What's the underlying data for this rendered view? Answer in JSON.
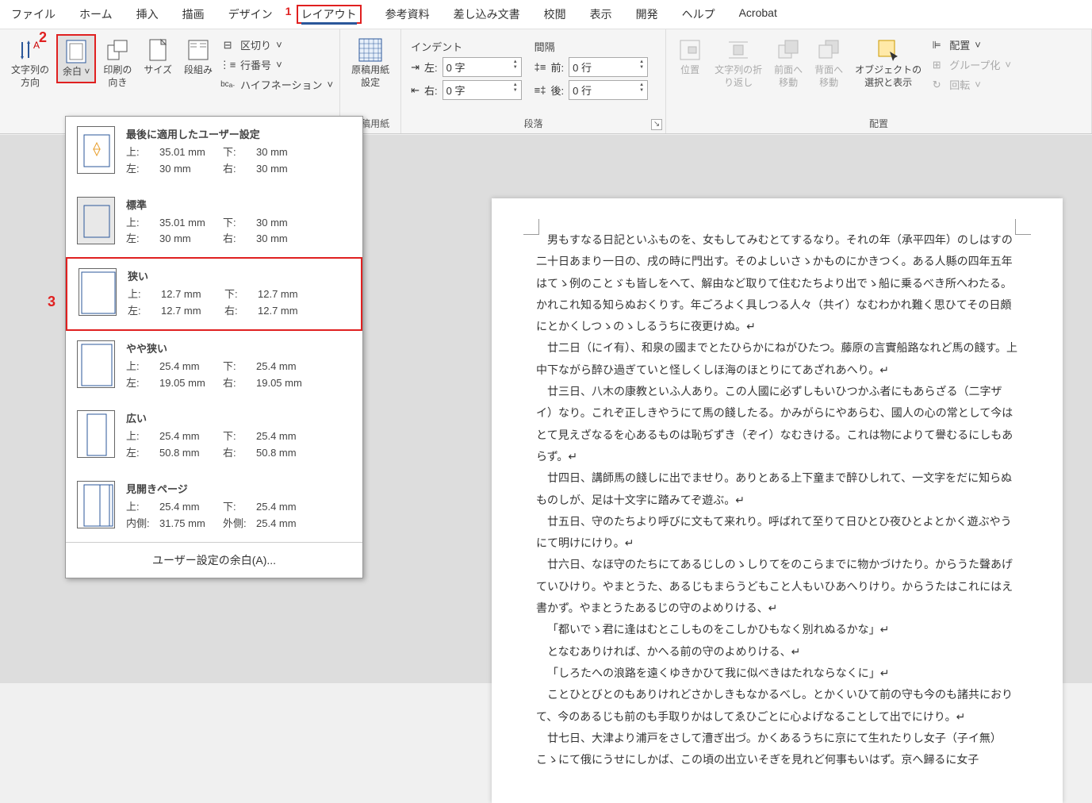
{
  "menu": [
    "ファイル",
    "ホーム",
    "挿入",
    "描画",
    "デザイン",
    "レイアウト",
    "参考資料",
    "差し込み文書",
    "校閲",
    "表示",
    "開発",
    "ヘルプ",
    "Acrobat"
  ],
  "annotations": {
    "layout": "1",
    "margins": "2",
    "narrow": "3"
  },
  "ribbon": {
    "text_direction": {
      "label": "文字列の\n方向"
    },
    "margins": {
      "label": "余白"
    },
    "orientation": {
      "label": "印刷の\n向き"
    },
    "size": {
      "label": "サイズ"
    },
    "columns": {
      "label": "段組み"
    },
    "breaks": {
      "label": "区切り"
    },
    "line_numbers": {
      "label": "行番号"
    },
    "hyphenation": {
      "label": "ハイフネーション"
    },
    "manuscript": {
      "label": "原稿用紙\n設定",
      "group": "原稿用紙"
    },
    "paragraph": {
      "group": "段落",
      "indent_hdr": "インデント",
      "spacing_hdr": "間隔",
      "left_lbl": "左:",
      "left_val": "0 字",
      "right_lbl": "右:",
      "right_val": "0 字",
      "before_lbl": "前:",
      "before_val": "0 行",
      "after_lbl": "後:",
      "after_val": "0 行"
    },
    "arrange": {
      "group": "配置",
      "position": "位置",
      "wrap": "文字列の折\nり返し",
      "bring_forward": "前面へ\n移動",
      "send_backward": "背面へ\n移動",
      "selection": "オブジェクトの\n選択と表示",
      "align": "配置",
      "group_obj": "グループ化",
      "rotate": "回転"
    }
  },
  "margins_dropdown": {
    "options": [
      {
        "name": "最後に適用したユーザー設定",
        "top": "35.01 mm",
        "bottom": "30 mm",
        "left": "30 mm",
        "right": "30 mm"
      },
      {
        "name": "標準",
        "top": "35.01 mm",
        "bottom": "30 mm",
        "left": "30 mm",
        "right": "30 mm"
      },
      {
        "name": "狭い",
        "top": "12.7 mm",
        "bottom": "12.7 mm",
        "left": "12.7 mm",
        "right": "12.7 mm"
      },
      {
        "name": "やや狭い",
        "top": "25.4 mm",
        "bottom": "25.4 mm",
        "left": "19.05 mm",
        "right": "19.05 mm"
      },
      {
        "name": "広い",
        "top": "25.4 mm",
        "bottom": "25.4 mm",
        "left": "50.8 mm",
        "right": "50.8 mm"
      },
      {
        "name": "見開きページ",
        "top": "25.4 mm",
        "bottom": "25.4 mm",
        "left": "31.75 mm",
        "right": "25.4 mm",
        "left_lbl": "内側:",
        "right_lbl": "外側:"
      }
    ],
    "labels": {
      "top": "上:",
      "bottom": "下:",
      "left": "左:",
      "right": "右:"
    },
    "custom": "ユーザー設定の余白(A)..."
  },
  "document": {
    "paragraphs": [
      "男もすなる日記といふものを、女もしてみむとてするなり。それの年（承平四年）のしはすの二十日あまり一日の、戌の時に門出す。そのよしいさゝかものにかきつく。ある人縣の四年五年はてゝ例のことゞも皆しをへて、解由など取りて住むたちより出でゝ船に乗るべき所へわたる。かれこれ知る知らぬおくりす。年ごろよく具しつる人々（共イ）なむわかれ難く思ひてその日頗にとかくしつゝのゝしるうちに夜更けぬ。↵",
      "廿二日（にイ有）、和泉の國までとたひらかにねがひたつ。藤原の言實船路なれど馬の餞す。上中下ながら醉ひ過ぎていと怪しくしほ海のほとりにてあざれあへり。↵",
      "廿三日、八木の康教といふ人あり。この人國に必ずしもいひつかふ者にもあらざる（二字ザイ）なり。これぞ正しきやうにて馬の餞したる。かみがらにやあらむ、國人の心の常として今はとて見えざなるを心あるものは恥ぢずき（ぞイ）なむきける。これは物によりて譽むるにしもあらず。↵",
      "廿四日、講師馬の餞しに出でませり。ありとある上下童まで醉ひしれて、一文字をだに知らぬものしが、足は十文字に踏みてぞ遊ぶ。↵",
      "廿五日、守のたちより呼びに文もて来れり。呼ばれて至りて日ひとひ夜ひとよとかく遊ぶやうにて明けにけり。↵",
      "廿六日、なほ守のたちにてあるじしのゝしりてをのこらまでに物かづけたり。からうた聲あげていひけり。やまとうた、あるじもまらうどもこと人もいひあへりけり。からうたはこれにはえ書かず。やまとうたあるじの守のよめりける、↵",
      "「都いでゝ君に逢はむとこしものをこしかひもなく別れぬるかな」↵",
      "となむありければ、かへる前の守のよめりける、↵",
      "「しろたへの浪路を遠くゆきかひて我に似べきはたれならなくに」↵",
      "ことひとびとのもありけれどさかしきもなかるべし。とかくいひて前の守も今のも諸共におりて、今のあるじも前のも手取りかはしてゑひごとに心よげなることして出でにけり。↵",
      "廿七日、大津より浦戸をさして漕ぎ出づ。かくあるうちに京にて生れたりし女子（子イ無）こゝにて俄にうせにしかば、この頃の出立いそぎを見れど何事もいはず。京へ歸るに女子"
    ]
  }
}
